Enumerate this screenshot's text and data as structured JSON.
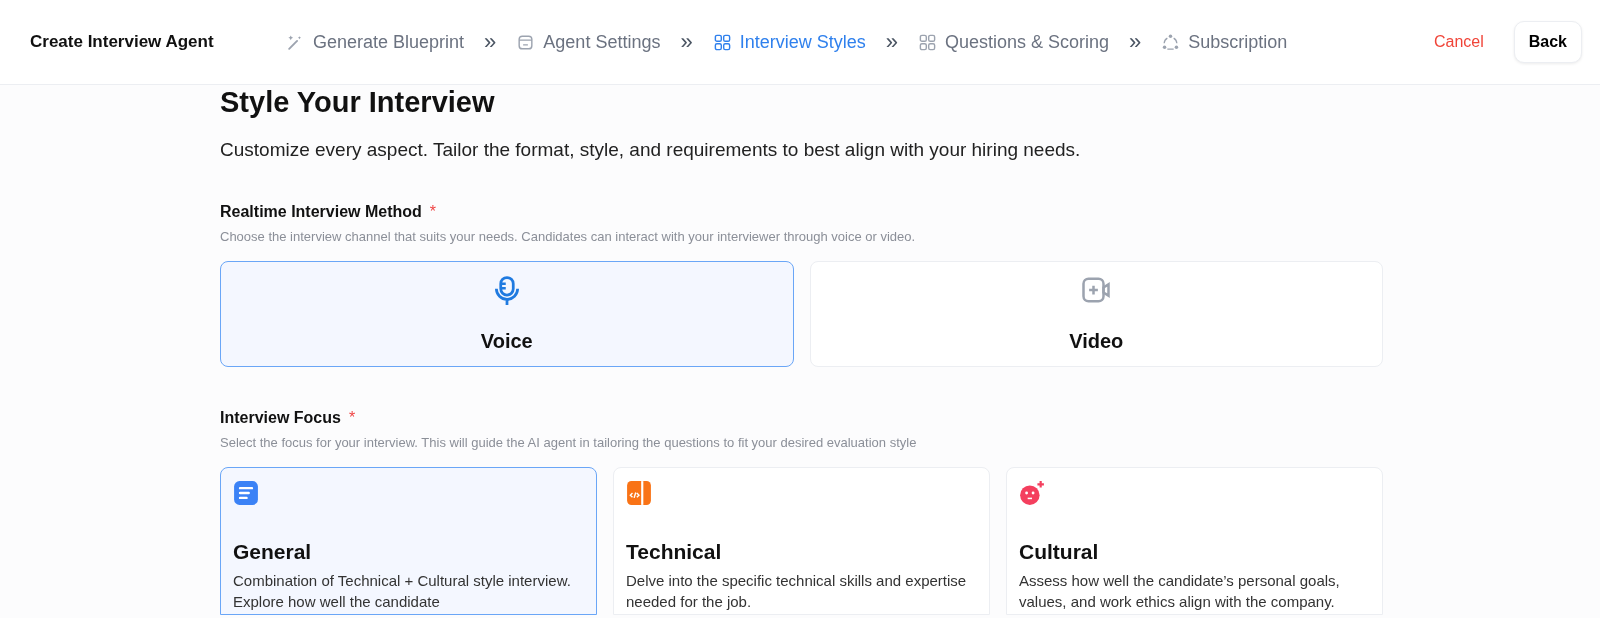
{
  "header": {
    "title": "Create Interview Agent",
    "steps": [
      {
        "label": "Generate Blueprint",
        "kind": "wand",
        "selected": false
      },
      {
        "label": "Agent Settings",
        "kind": "box",
        "selected": false
      },
      {
        "label": "Interview Styles",
        "kind": "grid",
        "selected": true
      },
      {
        "label": "Questions & Scoring",
        "kind": "grid",
        "selected": false
      },
      {
        "label": "Subscription",
        "kind": "cycle",
        "selected": false
      }
    ],
    "separator": "»",
    "cancel": "Cancel",
    "back": "Back"
  },
  "page": {
    "title": "Style Your Interview",
    "subtitle": "Customize every aspect. Tailor the format, style, and requirements to best align with your hiring needs."
  },
  "method": {
    "label": "Realtime Interview Method",
    "required": "*",
    "hint": "Choose the interview channel that suits your needs. Candidates can interact with your interviewer through voice or video.",
    "options": [
      {
        "label": "Voice",
        "kind": "mic",
        "selected": true
      },
      {
        "label": "Video",
        "kind": "video",
        "selected": false
      }
    ]
  },
  "focus": {
    "label": "Interview Focus",
    "required": "*",
    "hint": "Select the focus for your interview. This will guide the AI agent in tailoring the questions to fit your desired evaluation style",
    "options": [
      {
        "label": "General",
        "kind": "doc",
        "selected": true,
        "description": "Combination of Technical + Cultural style interview. Explore how well the candidate"
      },
      {
        "label": "Technical",
        "kind": "code",
        "selected": false,
        "description": "Delve into the specific technical skills and expertise needed for the job."
      },
      {
        "label": "Cultural",
        "kind": "face",
        "selected": false,
        "description": "Assess how well the candidate’s personal goals, values, and work ethics align with the company."
      }
    ]
  }
}
